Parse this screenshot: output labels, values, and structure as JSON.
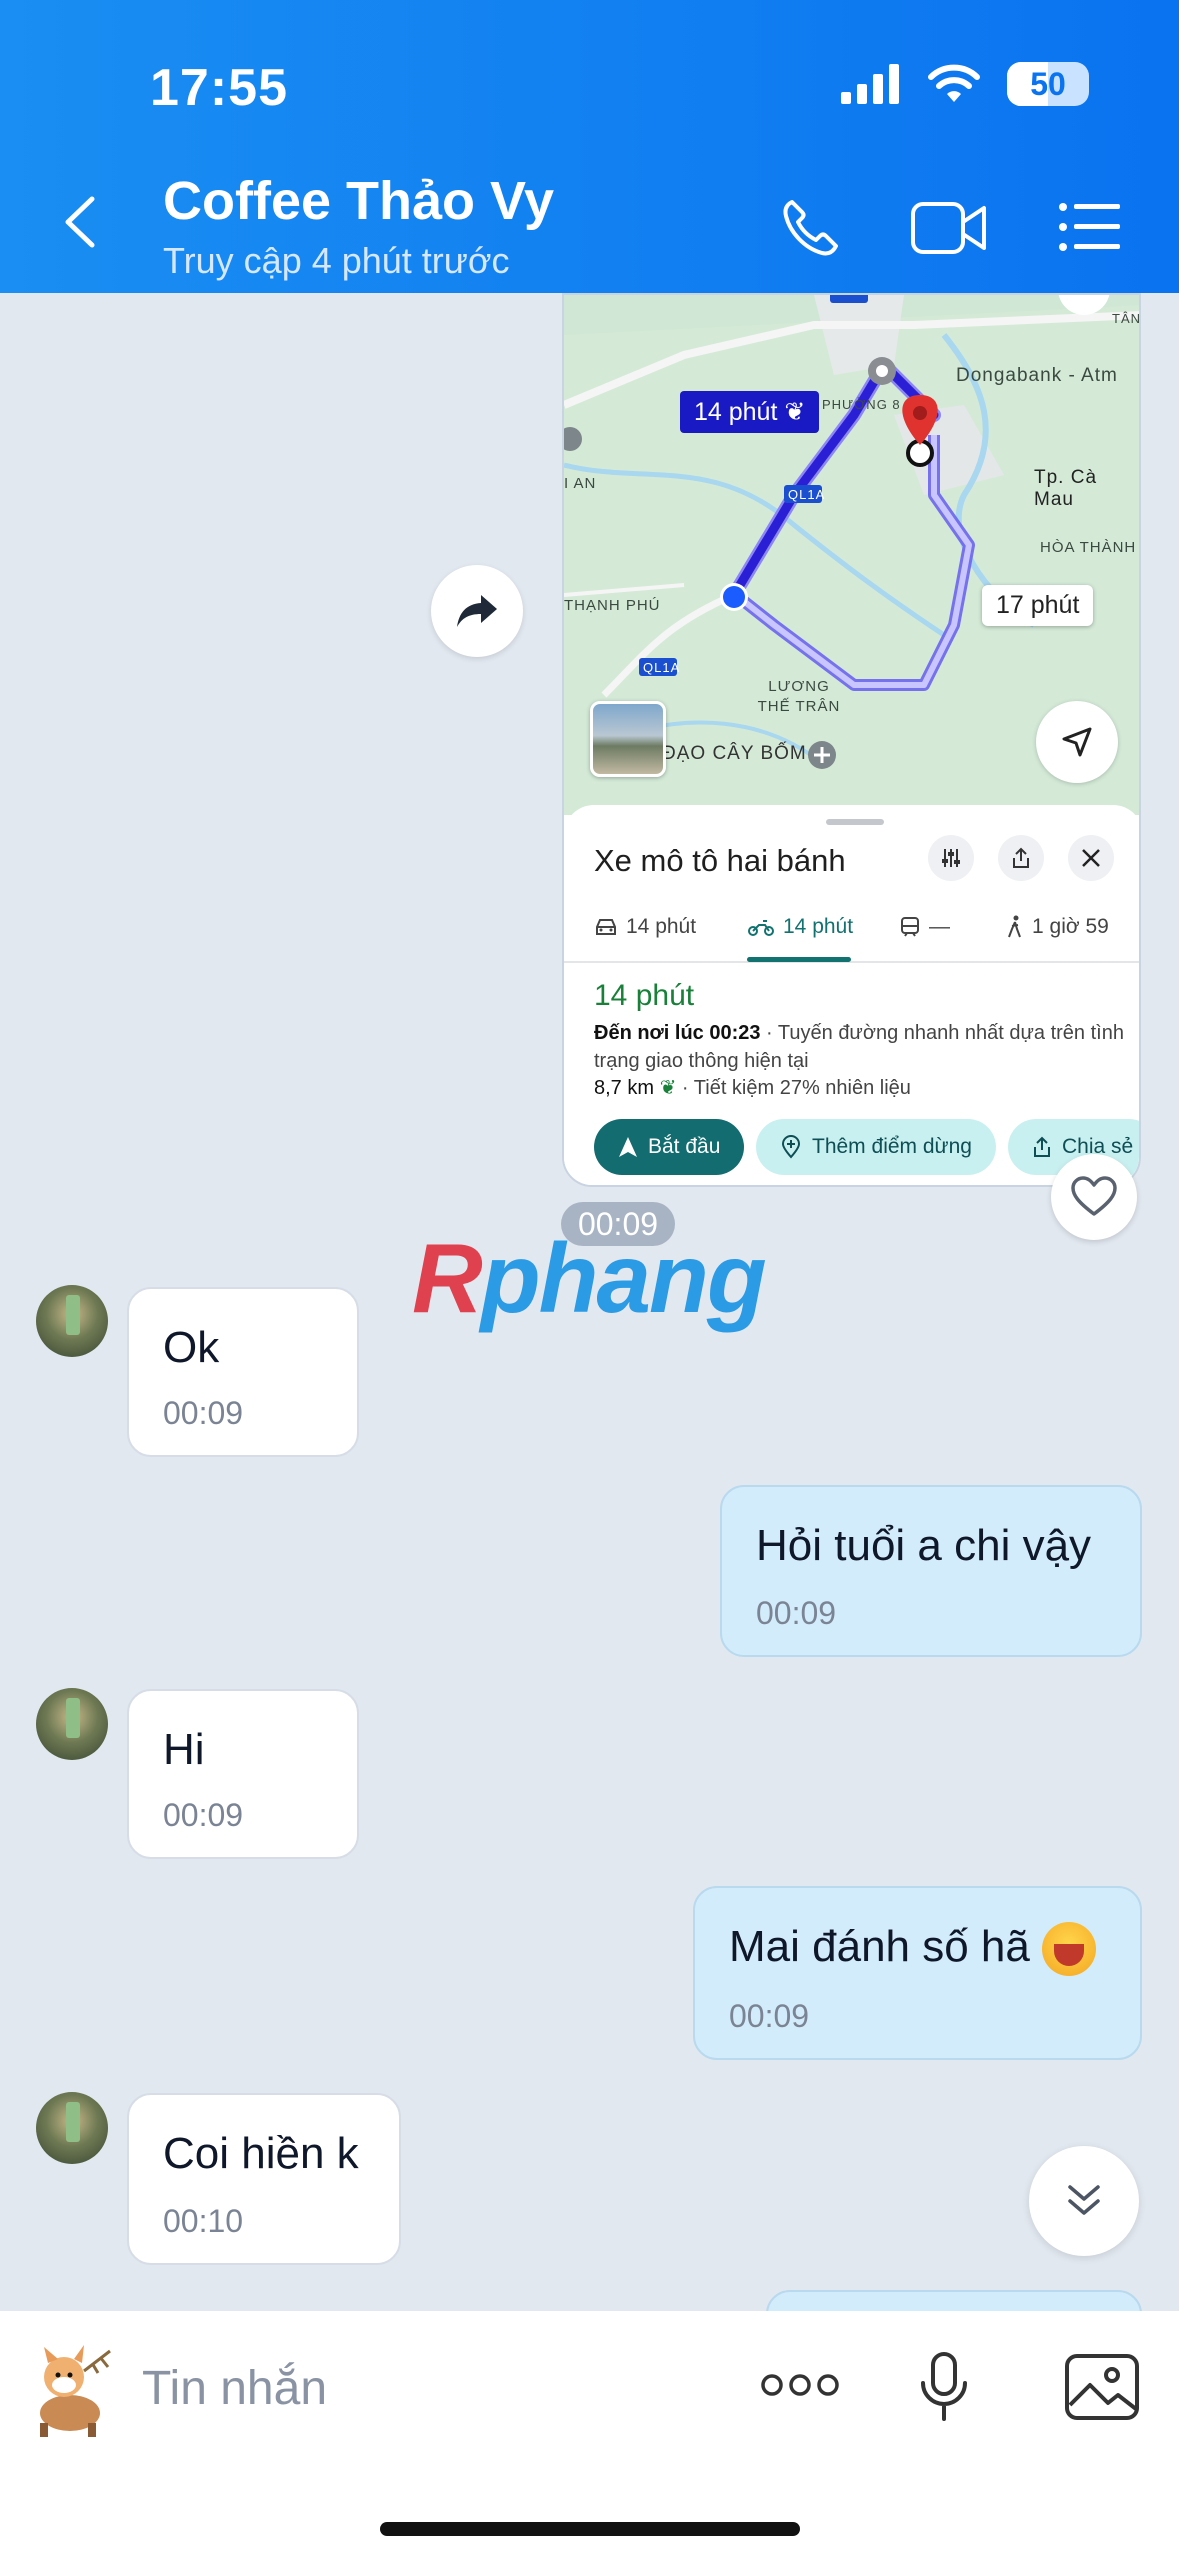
{
  "status_bar": {
    "time": "17:55",
    "battery": "50",
    "battery_level_percent": 50
  },
  "header": {
    "title": "Coffee Thảo Vy",
    "subtitle": "Truy cập 4 phút trước"
  },
  "map_card": {
    "map_labels": {
      "dongabank": "Dongabank - Atm",
      "ca_mau": "Tp. Cà Mau",
      "hoa_thanh": "HÒA THÀNH",
      "thanh_phu": "THẠNH PHÚ",
      "luong_the_tran": "LƯƠNG\nTHẾ TRÂN",
      "dao_cay_bom": "ĐẠO CÂY BỐM",
      "ql1a_1": "QL1A",
      "ql1a_2": "QL1A",
      "phuong": "PHƯỜNG 8",
      "tan": "TÂN",
      "oi_an": "I AN"
    },
    "route_tag_primary": "14 phút",
    "route_tag_alt": "17 phút",
    "panel": {
      "title": "Xe mô tô hai bánh",
      "tabs": [
        {
          "label": "14 phút",
          "icon": "car-icon"
        },
        {
          "label": "14 phút",
          "icon": "motorbike-icon"
        },
        {
          "label": "—",
          "icon": "transit-icon"
        },
        {
          "label": "1 giờ 59",
          "icon": "walk-icon"
        }
      ],
      "eta": "14 phút",
      "arrive_prefix": "Đến nơi lúc 00:23",
      "arrive_detail": " · Tuyến đường nhanh nhất dựa trên tình trạng giao thông hiện tại",
      "distance": "8,7 km",
      "saving": " · Tiết kiệm 27% nhiên liệu",
      "buttons": {
        "start": "Bắt đầu",
        "add_stop": "Thêm điểm dừng",
        "share": "Chia sẻ"
      }
    }
  },
  "map_time": "00:09",
  "watermark": {
    "first": "R",
    "rest": "phang"
  },
  "messages": [
    {
      "dir": "in",
      "text": "Ok",
      "time": "00:09"
    },
    {
      "dir": "out",
      "text": "Hỏi tuổi a chi vậy",
      "time": "00:09"
    },
    {
      "dir": "in",
      "text": "Hi",
      "time": "00:09"
    },
    {
      "dir": "out",
      "text": "Mai đánh số hã",
      "time": "00:09"
    },
    {
      "dir": "in",
      "text": "Coi hiền k",
      "time": "00:10"
    }
  ],
  "composer": {
    "placeholder": "Tin nhắn"
  },
  "colors": {
    "header_blue": "#0a73f0",
    "incoming_bubble": "#ffffff",
    "outgoing_bubble": "#d3ecfb",
    "route_primary": "#2b1fd6",
    "maps_teal": "#136c70",
    "eta_green": "#188038"
  }
}
